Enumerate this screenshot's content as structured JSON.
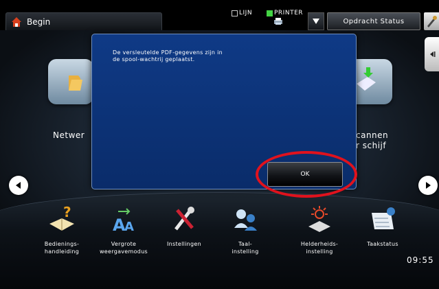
{
  "topbar": {
    "home_label": "Begin",
    "line_label": "LIJN",
    "printer_label": "PRINTER",
    "job_status_label": "Opdracht Status"
  },
  "desktop": {
    "network_label": "Netwer",
    "scan_label_line1": "cannen",
    "scan_label_line2": "r schijf"
  },
  "dialog": {
    "message_line1": "De versleutelde PDF-gegevens zijn in",
    "message_line2": "de spool-wachtrij geplaatst.",
    "ok_label": "OK"
  },
  "dock": {
    "items": [
      {
        "line1": "Bedienings-",
        "line2": "handleiding",
        "icon": "help-manual-icon"
      },
      {
        "line1": "Vergrote",
        "line2": "weergavemodus",
        "icon": "zoom-text-icon"
      },
      {
        "line1": "Instellingen",
        "line2": "",
        "icon": "tools-icon"
      },
      {
        "line1": "Taal-",
        "line2": "instelling",
        "icon": "language-icon"
      },
      {
        "line1": "Helderheids-",
        "line2": "instelling",
        "icon": "brightness-icon"
      },
      {
        "line1": "Taakstatus",
        "line2": "",
        "icon": "task-status-icon"
      }
    ]
  },
  "clock": "09:55",
  "colors": {
    "dialog_bg": "#0f3a86",
    "highlight": "#e0121d",
    "printer_active": "#44d444"
  }
}
